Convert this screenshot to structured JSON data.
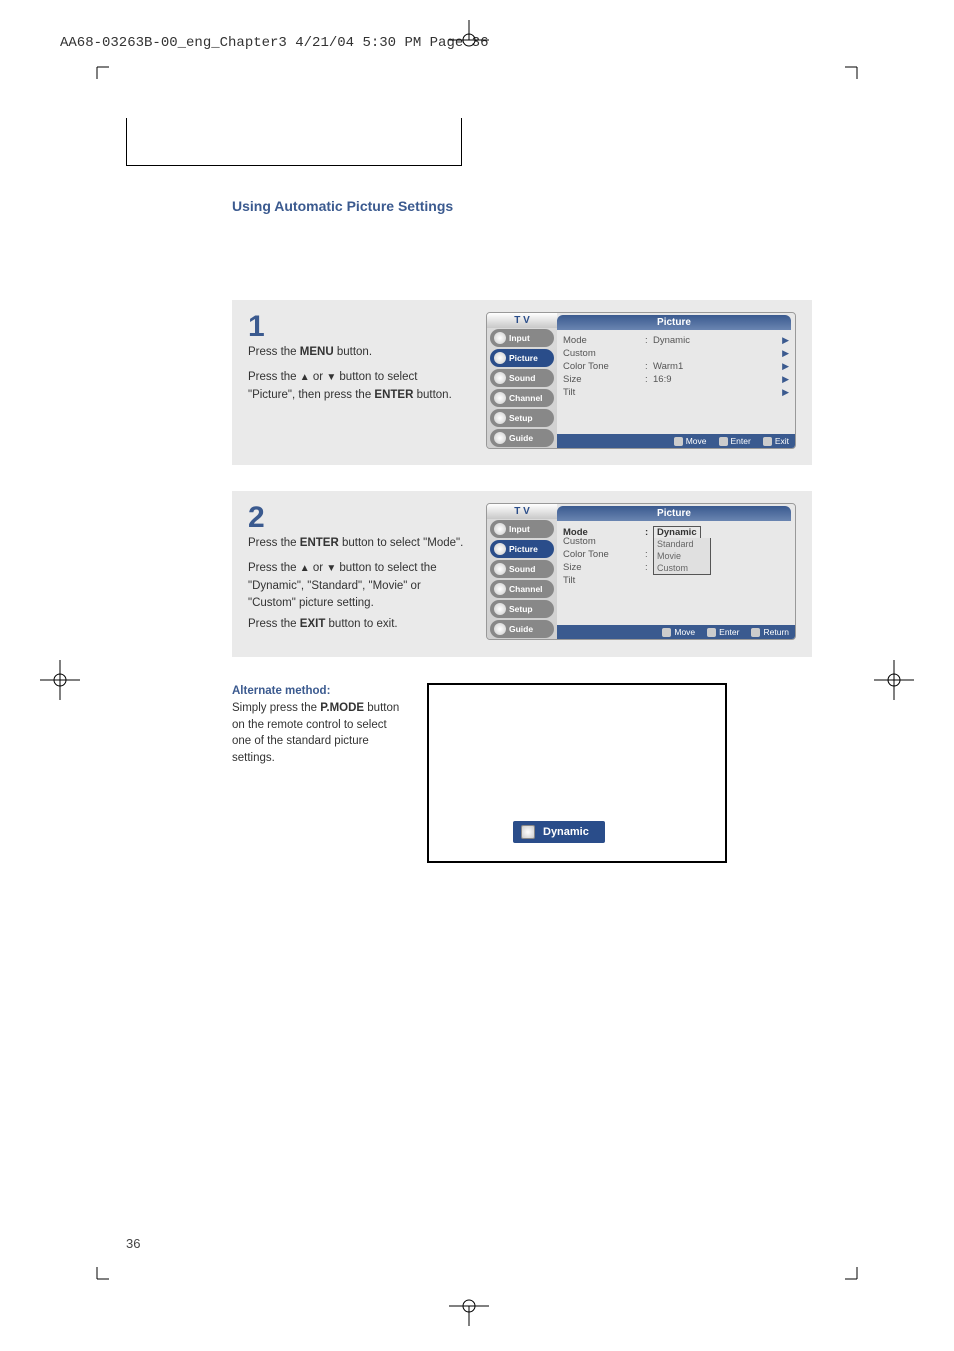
{
  "header_line": "AA68-03263B-00_eng_Chapter3  4/21/04  5:30 PM  Page 36",
  "section_title": "Using Automatic Picture Settings",
  "step1": {
    "num": "1",
    "p1_a": "Press the ",
    "p1_b": "MENU",
    "p1_c": " button.",
    "p2_a": "Press the ",
    "p2_b": " or ",
    "p2_c": " button to select \"Picture\", then press the ",
    "p2_d": "ENTER",
    "p2_e": " button."
  },
  "step2": {
    "num": "2",
    "p1_a": "Press the ",
    "p1_b": "ENTER",
    "p1_c": " button to select \"Mode\".",
    "p2_a": "Press the ",
    "p2_b": " or ",
    "p2_c": " button to select the \"Dynamic\", \"Standard\", \"Movie\" or \"Custom\" picture setting.",
    "p3_a": "Press the ",
    "p3_b": "EXIT",
    "p3_c": " button to exit."
  },
  "alt": {
    "heading": "Alternate method:",
    "body_a": "Simply press the ",
    "body_b": "P.MODE",
    "body_c": " button on the remote control to select one of the standard picture      settings."
  },
  "osd": {
    "tv": "T V",
    "title": "Picture",
    "nav": [
      "Input",
      "Picture",
      "Sound",
      "Channel",
      "Setup",
      "Guide"
    ],
    "rows1": [
      {
        "label": "Mode",
        "val": "Dynamic"
      },
      {
        "label": "Custom",
        "val": ""
      },
      {
        "label": "Color Tone",
        "val": "Warm1"
      },
      {
        "label": "Size",
        "val": "16:9"
      },
      {
        "label": "Tilt",
        "val": ""
      }
    ],
    "rows2_label": "Mode",
    "rows2_val": "Dynamic",
    "rows2_rest": [
      {
        "label": "Custom",
        "val": ""
      },
      {
        "label": "Color Tone",
        "val": ""
      },
      {
        "label": "Size",
        "val": ""
      },
      {
        "label": "Tilt",
        "val": ""
      }
    ],
    "dropdown": [
      "Standard",
      "Movie",
      "Custom"
    ],
    "footer1": [
      "Move",
      "Enter",
      "Exit"
    ],
    "footer2": [
      "Move",
      "Enter",
      "Return"
    ]
  },
  "toast": "Dynamic",
  "page_num": "36",
  "chart_data": null
}
